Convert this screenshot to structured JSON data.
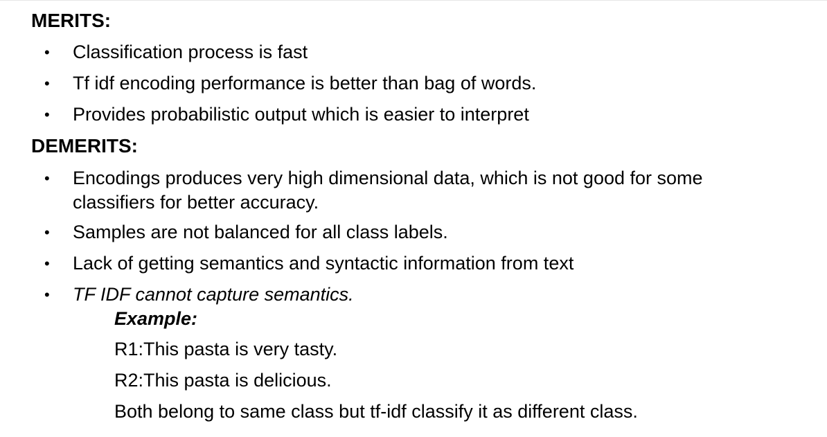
{
  "merits": {
    "heading": "MERITS:",
    "items": [
      "Classification process is fast",
      "Tf idf encoding performance is better than bag of words.",
      "Provides probabilistic output which is easier to interpret"
    ]
  },
  "demerits": {
    "heading": "DEMERITS:",
    "items": [
      "Encodings produces very high dimensional data, which is not good for some classifiers for better accuracy.",
      "Samples are not balanced for all class labels.",
      "Lack of getting semantics and syntactic information from text",
      "TF IDF cannot capture semantics."
    ]
  },
  "example": {
    "label": "Example:",
    "lines": [
      "R1:This pasta is very tasty.",
      "R2:This pasta is delicious.",
      "Both belong to same class but tf-idf classify it as different class."
    ]
  },
  "bullet_char": "•"
}
